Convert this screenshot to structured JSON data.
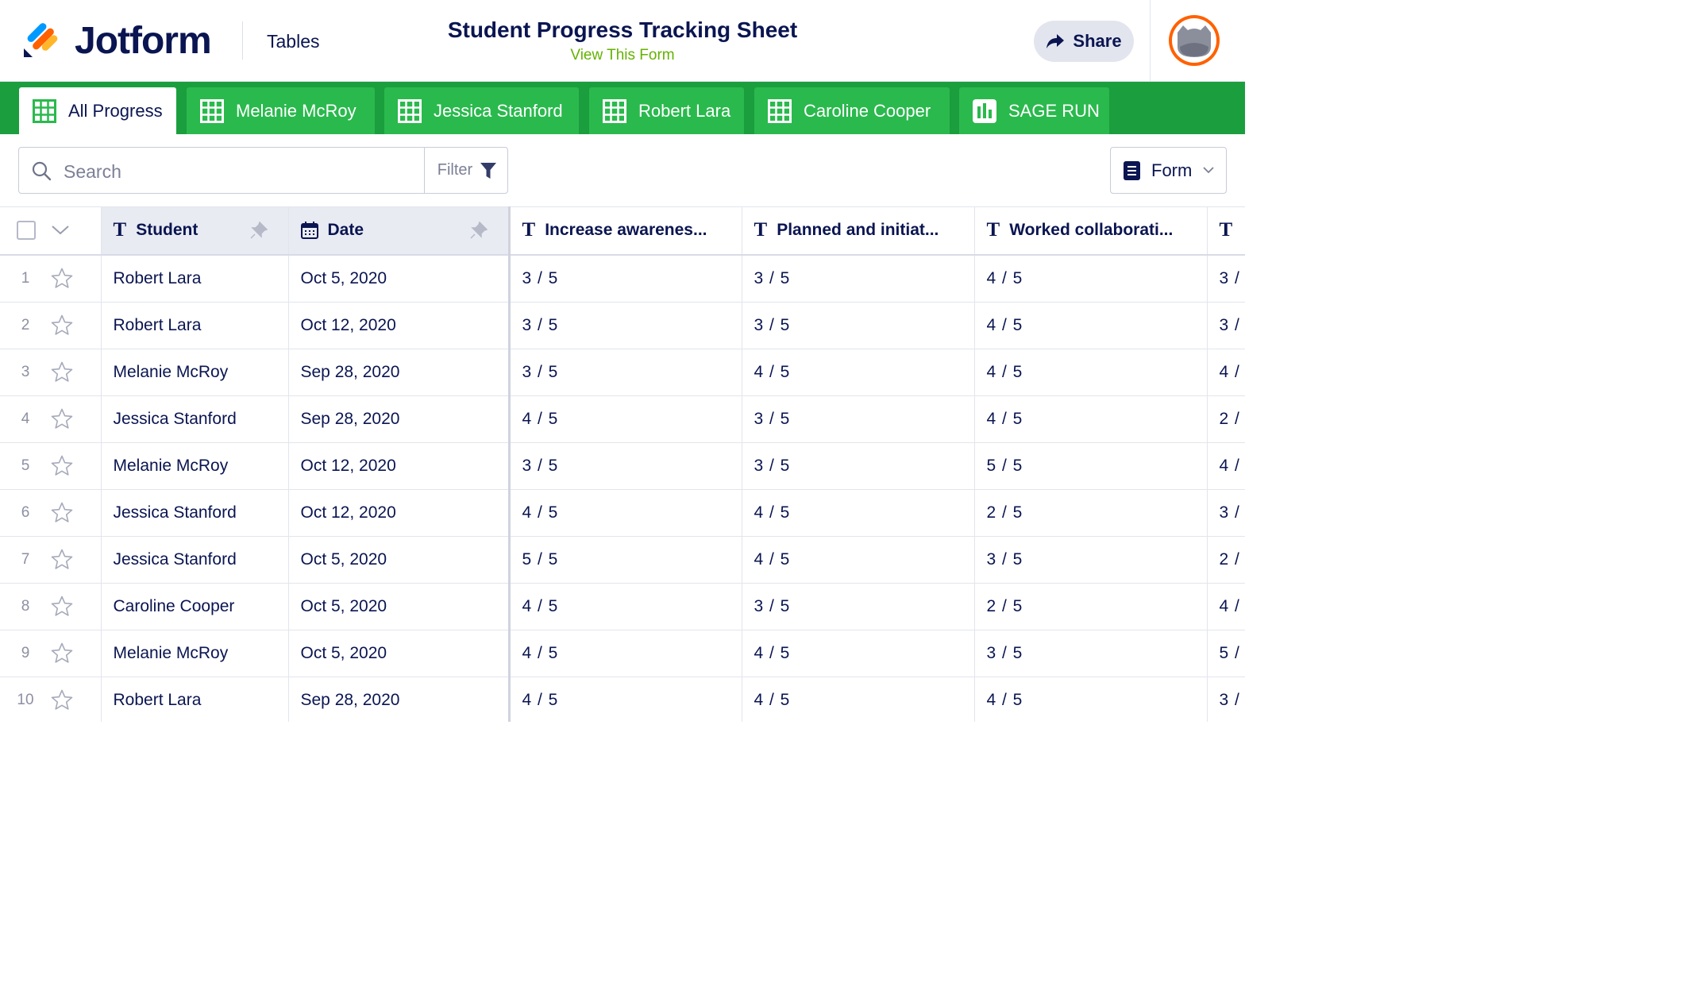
{
  "header": {
    "logo_text": "Jotform",
    "product": "Tables",
    "title": "Student Progress Tracking Sheet",
    "view_form": "View This Form",
    "share_label": "Share"
  },
  "colors": {
    "brand_navy": "#0a1551",
    "tab_bar_green": "#1b9e3e",
    "tab_green": "#2ab94d",
    "link_green": "#64b200",
    "avatar_orange": "#ff6100"
  },
  "tabs": [
    {
      "label": "All Progress",
      "icon": "grid-icon",
      "active": true
    },
    {
      "label": "Melanie McRoy",
      "icon": "grid-icon",
      "active": false
    },
    {
      "label": "Jessica Stanford",
      "icon": "grid-icon",
      "active": false
    },
    {
      "label": "Robert Lara",
      "icon": "grid-icon",
      "active": false
    },
    {
      "label": "Caroline Cooper",
      "icon": "grid-icon",
      "active": false
    },
    {
      "label": "SAGE RUN",
      "icon": "report-icon",
      "active": false
    }
  ],
  "toolbar": {
    "search_placeholder": "Search",
    "filter_label": "Filter",
    "form_label": "Form"
  },
  "table": {
    "columns": [
      {
        "label": "Student",
        "icon": "text-icon",
        "pinned": true
      },
      {
        "label": "Date",
        "icon": "calendar-icon",
        "pinned": true
      },
      {
        "label": "Increase awarenes...",
        "icon": "text-icon"
      },
      {
        "label": "Planned and initiat...",
        "icon": "text-icon"
      },
      {
        "label": "Worked collaborati...",
        "icon": "text-icon"
      },
      {
        "label": "",
        "icon": "text-icon"
      }
    ],
    "rows": [
      {
        "num": "1",
        "student": "Robert Lara",
        "date": "Oct 5, 2020",
        "q1": "3 / 5",
        "q2": "3 / 5",
        "q3": "4 / 5",
        "q4": "3 /"
      },
      {
        "num": "2",
        "student": "Robert Lara",
        "date": "Oct 12, 2020",
        "q1": "3 / 5",
        "q2": "3 / 5",
        "q3": "4 / 5",
        "q4": "3 /"
      },
      {
        "num": "3",
        "student": "Melanie McRoy",
        "date": "Sep 28, 2020",
        "q1": "3 / 5",
        "q2": "4 / 5",
        "q3": "4 / 5",
        "q4": "4 /"
      },
      {
        "num": "4",
        "student": "Jessica Stanford",
        "date": "Sep 28, 2020",
        "q1": "4 / 5",
        "q2": "3 / 5",
        "q3": "4 / 5",
        "q4": "2 /"
      },
      {
        "num": "5",
        "student": "Melanie McRoy",
        "date": "Oct 12, 2020",
        "q1": "3 / 5",
        "q2": "3 / 5",
        "q3": "5 / 5",
        "q4": "4 /"
      },
      {
        "num": "6",
        "student": "Jessica Stanford",
        "date": "Oct 12, 2020",
        "q1": "4 / 5",
        "q2": "4 / 5",
        "q3": "2 / 5",
        "q4": "3 /"
      },
      {
        "num": "7",
        "student": "Jessica Stanford",
        "date": "Oct 5, 2020",
        "q1": "5 / 5",
        "q2": "4 / 5",
        "q3": "3 / 5",
        "q4": "2 /"
      },
      {
        "num": "8",
        "student": "Caroline Cooper",
        "date": "Oct 5, 2020",
        "q1": "4 / 5",
        "q2": "3 / 5",
        "q3": "2 / 5",
        "q4": "4 /"
      },
      {
        "num": "9",
        "student": "Melanie McRoy",
        "date": "Oct 5, 2020",
        "q1": "4 / 5",
        "q2": "4 / 5",
        "q3": "3 / 5",
        "q4": "5 /"
      },
      {
        "num": "10",
        "student": "Robert Lara",
        "date": "Sep 28, 2020",
        "q1": "4 / 5",
        "q2": "4 / 5",
        "q3": "4 / 5",
        "q4": "3 /"
      }
    ]
  }
}
